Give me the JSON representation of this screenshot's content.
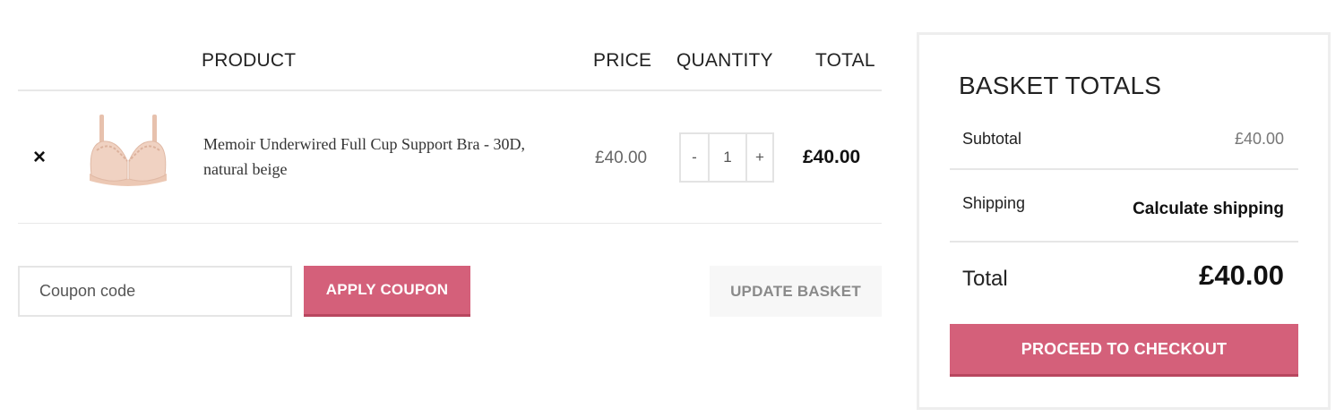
{
  "cart": {
    "headers": {
      "product": "PRODUCT",
      "price": "PRICE",
      "quantity": "QUANTITY",
      "total": "TOTAL"
    },
    "items": [
      {
        "remove_symbol": "×",
        "name": "Memoir Underwired Full Cup Support Bra - 30D, natural beige",
        "price": "£40.00",
        "quantity": "1",
        "qty_minus": "-",
        "qty_plus": "+",
        "total": "£40.00",
        "thumb_icon": "bra-product-image",
        "thumb_color": "#f0d2c2"
      }
    ]
  },
  "actions": {
    "coupon_placeholder": "Coupon code",
    "apply_coupon": "APPLY COUPON",
    "update_basket": "UPDATE BASKET"
  },
  "totals": {
    "title": "BASKET TOTALS",
    "subtotal_label": "Subtotal",
    "subtotal_value": "£40.00",
    "shipping_label": "Shipping",
    "shipping_link": "Calculate shipping",
    "total_label": "Total",
    "total_value": "£40.00",
    "checkout": "PROCEED TO CHECKOUT"
  },
  "colors": {
    "accent": "#d4607a",
    "border": "#eeeeee"
  }
}
